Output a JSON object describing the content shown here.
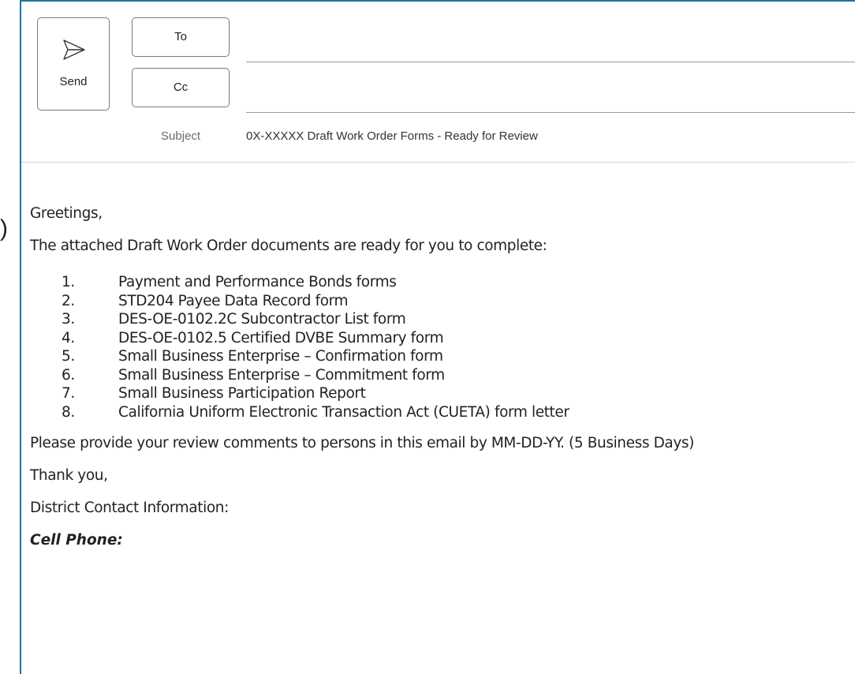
{
  "stray_glyph": ")",
  "toolbar": {
    "send_label": "Send",
    "to_label": "To",
    "cc_label": "Cc"
  },
  "fields": {
    "to_value": "",
    "cc_value": "",
    "subject_label": "Subject",
    "subject_value": "0X-XXXXX Draft Work Order Forms - Ready for Review"
  },
  "message": {
    "greeting": "Greetings,",
    "intro": "The attached Draft Work Order documents are ready for you to complete:",
    "documents": [
      {
        "num": "1.",
        "text": "Payment and Performance Bonds forms"
      },
      {
        "num": "2.",
        "text": "STD204 Payee Data Record form"
      },
      {
        "num": "3.",
        "text": "DES-OE-0102.2C Subcontractor List form"
      },
      {
        "num": "4.",
        "text": "DES-OE-0102.5 Certified DVBE Summary form"
      },
      {
        "num": "5.",
        "text": "Small Business Enterprise – Confirmation form"
      },
      {
        "num": "6.",
        "text": "Small Business Enterprise – Commitment form"
      },
      {
        "num": "7.",
        "text": "Small Business Participation Report"
      },
      {
        "num": "8.",
        "text": "California Uniform Electronic Transaction Act (CUETA) form letter"
      }
    ],
    "review_request": "Please provide your review comments to persons in this email by MM-DD-YY. (5 Business Days)",
    "thanks": "Thank you,",
    "contact_heading": "District Contact Information:",
    "cell_phone_label": "Cell Phone:"
  },
  "colors": {
    "frame_border": "#2e6f8a",
    "button_border": "#7a7a7a",
    "subject_label": "#6a6a6a"
  },
  "icons": {
    "send": "send-icon"
  }
}
